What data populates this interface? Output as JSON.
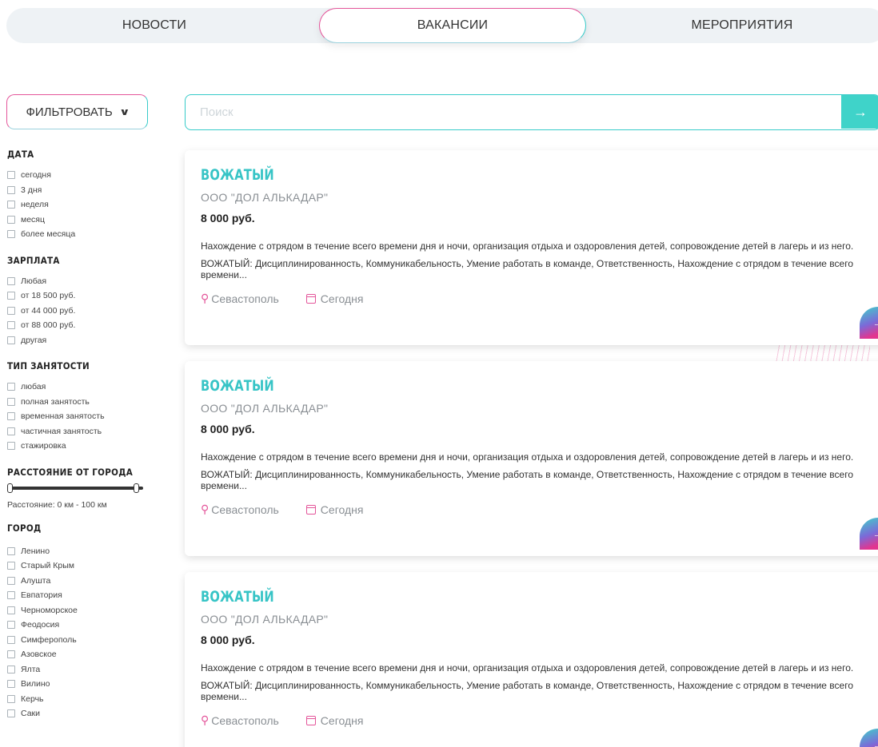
{
  "tabs": {
    "news": "НОВОСТИ",
    "vacancies": "ВАКАНСИИ",
    "events": "МЕРОПРИЯТИЯ"
  },
  "filter_button": "ФИЛЬТРОВАТЬ",
  "search": {
    "placeholder": "Поиск",
    "value": "",
    "go_icon": "→"
  },
  "filters": {
    "date": {
      "title": "ДАТА",
      "options": [
        "сегодня",
        "3 дня",
        "неделя",
        "месяц",
        "более месяца"
      ]
    },
    "salary": {
      "title": "ЗАРПЛАТА",
      "options": [
        "Любая",
        "от 18 500 руб.",
        "от 44 000 руб.",
        "от 88 000 руб.",
        "другая"
      ]
    },
    "employment": {
      "title": "ТИП ЗАНЯТОСТИ",
      "options": [
        "любая",
        "полная занятость",
        "временная занятость",
        "частичная занятость",
        "стажировка"
      ]
    },
    "distance": {
      "title": "РАССТОЯНИЕ ОТ ГОРОДА",
      "label": "Расстояние: 0 км - 100 км",
      "min": 0,
      "max": 100
    },
    "city": {
      "title": "ГОРОД",
      "options": [
        "Ленино",
        "Старый Крым",
        "Алушта",
        "Евпатория",
        "Черноморское",
        "Феодосия",
        "Симферополь",
        "Азовское",
        "Ялта",
        "Вилино",
        "Керчь",
        "Саки"
      ]
    }
  },
  "vacancies": [
    {
      "title": "ВОЖАТЫЙ",
      "company": "ООО \"ДОЛ АЛЬКАДАР\"",
      "salary": "8 000 руб.",
      "description": "Нахождение с отрядом в течение всего времени дня и ночи, организация отдыха и оздоровления детей, сопровождение детей в лагерь и из него.",
      "requirements": "ВОЖАТЫЙ: Дисциплинированность, Коммуникабельность, Умение работать в команде, Ответственность, Нахождение с отрядом в течение всего времени...",
      "city": "Севастополь",
      "date": "Сегодня"
    },
    {
      "title": "ВОЖАТЫЙ",
      "company": "ООО \"ДОЛ АЛЬКАДАР\"",
      "salary": "8 000 руб.",
      "description": "Нахождение с отрядом в течение всего времени дня и ночи, организация отдыха и оздоровления детей, сопровождение детей в лагерь и из него.",
      "requirements": "ВОЖАТЫЙ: Дисциплинированность, Коммуникабельность, Умение работать в команде, Ответственность, Нахождение с отрядом в течение всего времени...",
      "city": "Севастополь",
      "date": "Сегодня"
    },
    {
      "title": "ВОЖАТЫЙ",
      "company": "ООО \"ДОЛ АЛЬКАДАР\"",
      "salary": "8 000 руб.",
      "description": "Нахождение с отрядом в течение всего времени дня и ночи, организация отдыха и оздоровления детей, сопровождение детей в лагерь и из него.",
      "requirements": "ВОЖАТЫЙ: Дисциплинированность, Коммуникабельность, Умение работать в команде, Ответственность, Нахождение с отрядом в течение всего времени...",
      "city": "Севастополь",
      "date": "Сегодня"
    }
  ],
  "icons": {
    "card_go": "→",
    "location": "location-pin-icon",
    "calendar": "calendar-icon"
  },
  "colors": {
    "accent_teal": "#37c4c6",
    "accent_pink": "#e4559a"
  }
}
